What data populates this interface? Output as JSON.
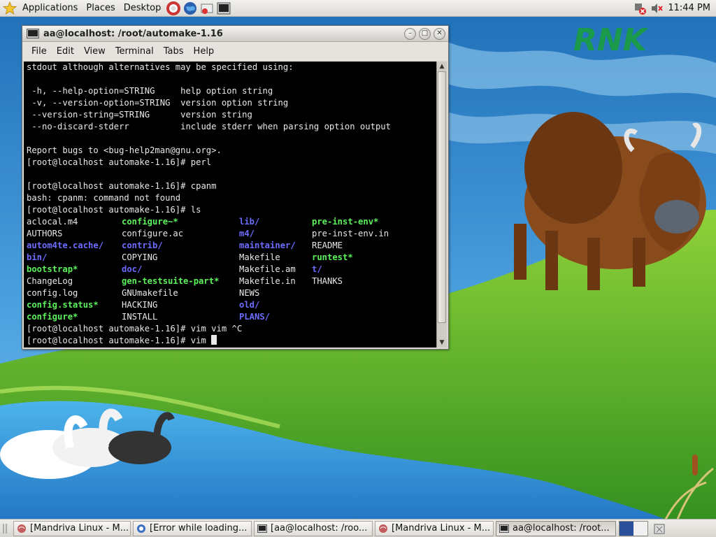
{
  "top_panel": {
    "menus": [
      "Applications",
      "Places",
      "Desktop"
    ],
    "clock": "11:44 PM"
  },
  "wallpaper": {
    "logo_text": "RNK"
  },
  "window": {
    "title": "aa@localhost: /root/automake-1.16",
    "menubar": [
      "File",
      "Edit",
      "View",
      "Terminal",
      "Tabs",
      "Help"
    ],
    "terminal": {
      "lines": [
        "stdout although alternatives may be specified using:",
        "",
        " -h, --help-option=STRING     help option string",
        " -v, --version-option=STRING  version option string",
        " --version-string=STRING      version string",
        " --no-discard-stderr          include stderr when parsing option output",
        "",
        "Report bugs to <bug-help2man@gnu.org>.",
        "[root@localhost automake-1.16]# perl",
        "",
        "[root@localhost automake-1.16]# cpanm",
        "bash: cpanm: command not found",
        "[root@localhost automake-1.16]# ls"
      ],
      "ls_rows": [
        [
          [
            "aclocal.m4",
            ""
          ],
          [
            "configure~*",
            "green"
          ],
          [
            "lib/",
            "blue"
          ],
          [
            "pre-inst-env*",
            "green"
          ]
        ],
        [
          [
            "AUTHORS",
            ""
          ],
          [
            "configure.ac",
            ""
          ],
          [
            "m4/",
            "blue"
          ],
          [
            "pre-inst-env.in",
            ""
          ]
        ],
        [
          [
            "autom4te.cache/",
            "blue"
          ],
          [
            "contrib/",
            "blue"
          ],
          [
            "maintainer/",
            "blue"
          ],
          [
            "README",
            ""
          ]
        ],
        [
          [
            "bin/",
            "blue"
          ],
          [
            "COPYING",
            ""
          ],
          [
            "Makefile",
            ""
          ],
          [
            "runtest*",
            "green"
          ]
        ],
        [
          [
            "bootstrap*",
            "green"
          ],
          [
            "doc/",
            "blue"
          ],
          [
            "Makefile.am",
            ""
          ],
          [
            "t/",
            "blue"
          ]
        ],
        [
          [
            "ChangeLog",
            ""
          ],
          [
            "gen-testsuite-part*",
            "green"
          ],
          [
            "Makefile.in",
            ""
          ],
          [
            "THANKS",
            ""
          ]
        ],
        [
          [
            "config.log",
            ""
          ],
          [
            "GNUmakefile",
            ""
          ],
          [
            "NEWS",
            ""
          ],
          [
            "",
            ""
          ]
        ],
        [
          [
            "config.status*",
            "green"
          ],
          [
            "HACKING",
            ""
          ],
          [
            "old/",
            "blue"
          ],
          [
            "",
            ""
          ]
        ],
        [
          [
            "configure*",
            "green"
          ],
          [
            "INSTALL",
            ""
          ],
          [
            "PLANS/",
            "blue"
          ],
          [
            "",
            ""
          ]
        ]
      ],
      "after_lines": [
        "[root@localhost automake-1.16]# vim vim ^C"
      ],
      "prompt_line": "[root@localhost automake-1.16]# vim "
    }
  },
  "taskbar": {
    "tasks": [
      {
        "label": "[Mandriva Linux - M...",
        "icon": "browser-icon",
        "active": false
      },
      {
        "label": "[Error while loading...",
        "icon": "dialog-icon",
        "active": false
      },
      {
        "label": "[aa@localhost: /roo...",
        "icon": "terminal-icon",
        "active": false
      },
      {
        "label": "[Mandriva Linux - M...",
        "icon": "browser-icon",
        "active": false
      },
      {
        "label": "aa@localhost: /root...",
        "icon": "terminal-icon",
        "active": true
      }
    ]
  },
  "colors": {
    "terminal_bg": "#000000",
    "terminal_fg": "#e8e8e8",
    "dir_blue": "#6c6cff",
    "exec_green": "#5cf25c"
  }
}
